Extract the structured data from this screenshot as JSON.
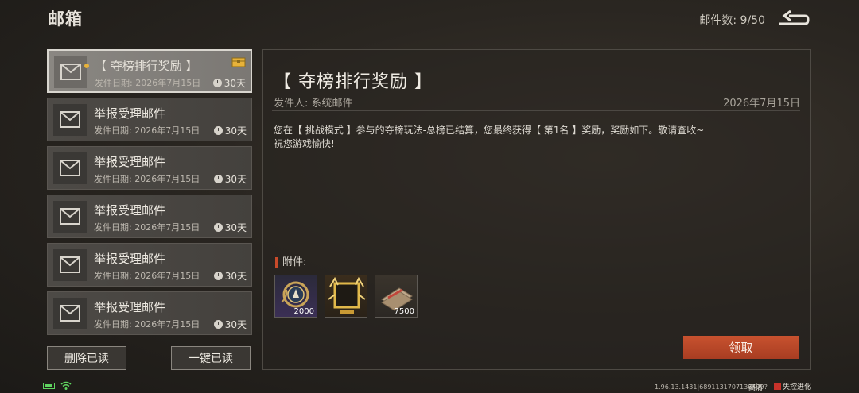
{
  "header": {
    "title": "邮箱",
    "mail_count": "邮件数: 9/50"
  },
  "mails": [
    {
      "subject": "【 夺榜排行奖励 】",
      "date": "发件日期: 2026年7月15日",
      "days": "30天",
      "selected": true,
      "unread": true,
      "has_attachment": true
    },
    {
      "subject": "举报受理邮件",
      "date": "发件日期: 2026年7月15日",
      "days": "30天"
    },
    {
      "subject": "举报受理邮件",
      "date": "发件日期: 2026年7月15日",
      "days": "30天"
    },
    {
      "subject": "举报受理邮件",
      "date": "发件日期: 2026年7月15日",
      "days": "30天"
    },
    {
      "subject": "举报受理邮件",
      "date": "发件日期: 2026年7月15日",
      "days": "30天"
    },
    {
      "subject": "举报受理邮件",
      "date": "发件日期: 2026年7月15日",
      "days": "30天"
    }
  ],
  "buttons": {
    "delete_read": "删除已读",
    "mark_all_read": "一键已读",
    "claim": "领取"
  },
  "detail": {
    "title": "【 夺榜排行奖励 】",
    "sender": "发件人:  系统邮件",
    "date": "2026年7月15日",
    "body_line1": "您在【 挑战模式 】参与的夺榜玩法-总榜已结算，您最终获得【 第1名 】奖励，奖励如下。敬请查收~",
    "body_line2": "祝您游戏愉快!",
    "attachments_label": "附件:",
    "attachments": [
      {
        "icon": "medal-icon",
        "count": "2000"
      },
      {
        "icon": "avatar-frame-icon",
        "count": ""
      },
      {
        "icon": "cash-bundle-icon",
        "count": "7500"
      }
    ]
  },
  "status_bar": {
    "version": "1.96.13.1431|6891131707136409?",
    "quality": "高清",
    "logo_text": "失控进化"
  },
  "colors": {
    "accent": "#c84a2a",
    "unread_dot": "#e7b23a"
  }
}
